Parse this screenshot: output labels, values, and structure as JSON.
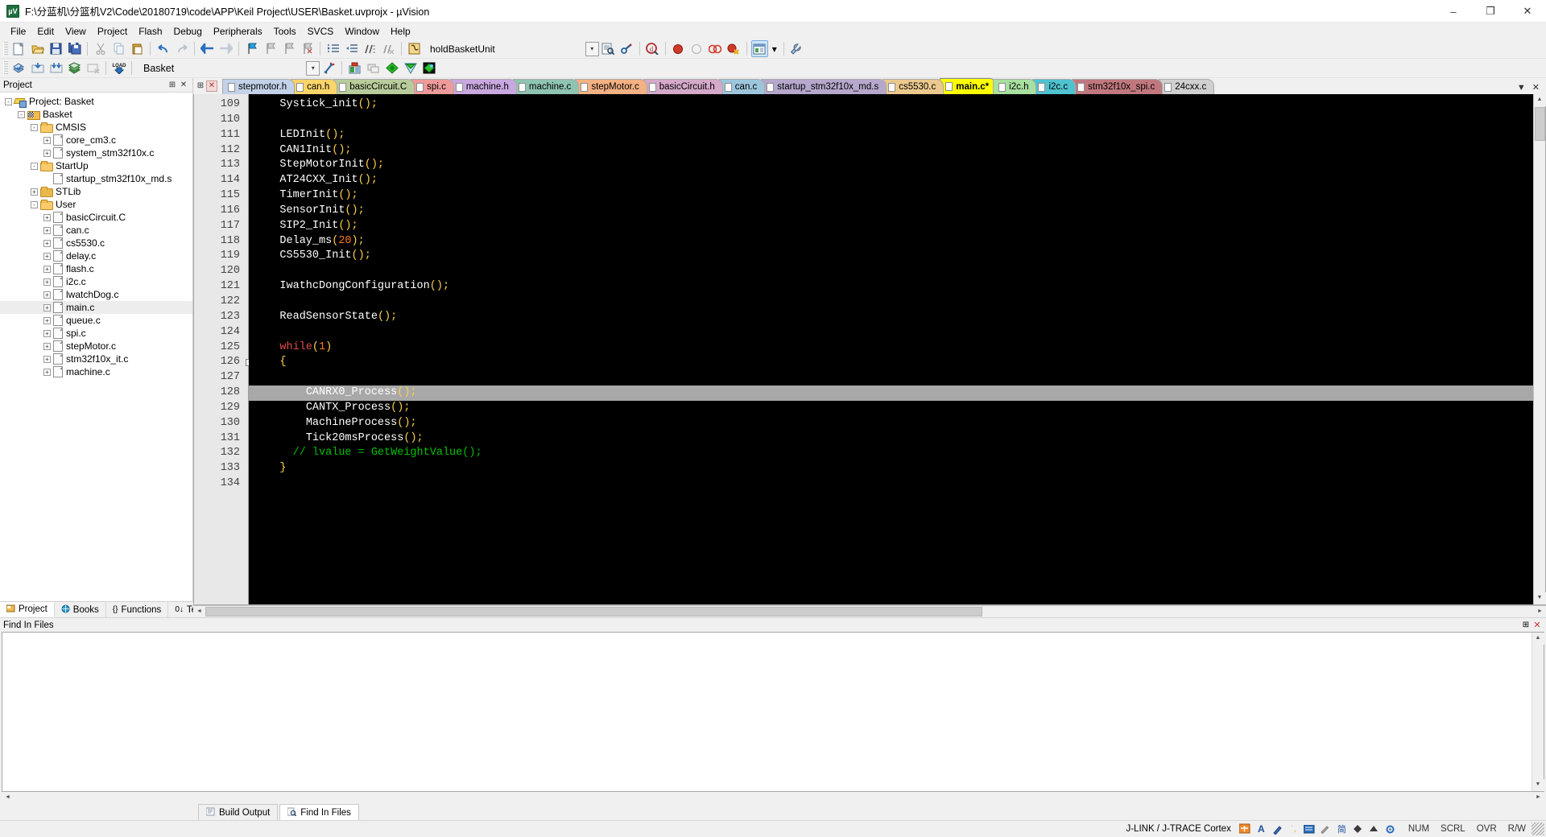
{
  "window": {
    "title": "F:\\分蓝机\\分篮机V2\\Code\\20180719\\code\\APP\\Keil Project\\USER\\Basket.uvprojx - µVision",
    "app_icon": "keil-uvision-icon",
    "minimize": "–",
    "maximize": "❐",
    "close": "✕"
  },
  "menu": [
    {
      "label": "File"
    },
    {
      "label": "Edit"
    },
    {
      "label": "View"
    },
    {
      "label": "Project"
    },
    {
      "label": "Flash"
    },
    {
      "label": "Debug"
    },
    {
      "label": "Peripherals"
    },
    {
      "label": "Tools"
    },
    {
      "label": "SVCS"
    },
    {
      "label": "Window"
    },
    {
      "label": "Help"
    }
  ],
  "toolbar_main": {
    "function_combo_value": "holdBasketUnit",
    "icons": [
      "new-file-icon",
      "open-file-icon",
      "save-icon",
      "save-all-icon",
      "cut-icon",
      "copy-icon",
      "paste-icon",
      "undo-icon",
      "redo-icon",
      "back-icon",
      "forward-icon",
      "bookmark-toggle-icon",
      "bookmark-prev-icon",
      "bookmark-next-icon",
      "bookmark-clear-icon",
      "indent-icon",
      "outdent-icon",
      "comment-icon",
      "uncomment-icon",
      "function-browse-icon"
    ],
    "right_icons": [
      "dropdown-arrow-icon",
      "find-in-files-icon",
      "configure-icon",
      "start-debug-icon",
      "breakpoint-icon",
      "breakpoint-disable-icon",
      "breakpoint-clear-icon",
      "breakpoint-kill-icon",
      "window-layout-icon",
      "layout-dropdown-icon",
      "configure-target-icon"
    ]
  },
  "toolbar_build": {
    "target_name": "Basket",
    "icons": [
      "translate-icon",
      "build-icon",
      "rebuild-icon",
      "batch-build-icon",
      "stop-build-icon",
      "download-icon"
    ],
    "right_icons": [
      "target-dropdown-icon",
      "target-options-icon",
      "manage-project-items-icon",
      "multi-project-icon",
      "component-icon",
      "pack-installer-icon",
      "pack-manage-icon"
    ]
  },
  "project_panel": {
    "title": "Project",
    "pin_icon": "pin-icon",
    "close_icon": "close-icon",
    "tree": [
      {
        "label": "Project: Basket",
        "depth": 0,
        "icon": "project-icon",
        "expander": "-"
      },
      {
        "label": "Basket",
        "depth": 1,
        "icon": "target-icon",
        "expander": "-"
      },
      {
        "label": "CMSIS",
        "depth": 2,
        "icon": "folder-open-icon",
        "expander": "-"
      },
      {
        "label": "core_cm3.c",
        "depth": 3,
        "icon": "file-icon",
        "expander": "+"
      },
      {
        "label": "system_stm32f10x.c",
        "depth": 3,
        "icon": "file-icon",
        "expander": "+"
      },
      {
        "label": "StartUp",
        "depth": 2,
        "icon": "folder-open-icon",
        "expander": "-"
      },
      {
        "label": "startup_stm32f10x_md.s",
        "depth": 3,
        "icon": "file-icon",
        "expander": ""
      },
      {
        "label": "STLib",
        "depth": 2,
        "icon": "folder-closed-icon",
        "expander": "+"
      },
      {
        "label": "User",
        "depth": 2,
        "icon": "folder-open-icon",
        "expander": "-"
      },
      {
        "label": "basicCircuit.C",
        "depth": 3,
        "icon": "file-icon",
        "expander": "+"
      },
      {
        "label": "can.c",
        "depth": 3,
        "icon": "file-icon",
        "expander": "+"
      },
      {
        "label": "cs5530.c",
        "depth": 3,
        "icon": "file-icon",
        "expander": "+"
      },
      {
        "label": "delay.c",
        "depth": 3,
        "icon": "file-icon",
        "expander": "+"
      },
      {
        "label": "flash.c",
        "depth": 3,
        "icon": "file-icon",
        "expander": "+"
      },
      {
        "label": "i2c.c",
        "depth": 3,
        "icon": "file-icon",
        "expander": "+"
      },
      {
        "label": "lwatchDog.c",
        "depth": 3,
        "icon": "file-icon",
        "expander": "+"
      },
      {
        "label": "main.c",
        "depth": 3,
        "icon": "file-icon",
        "expander": "+",
        "selected": true
      },
      {
        "label": "queue.c",
        "depth": 3,
        "icon": "file-icon",
        "expander": "+"
      },
      {
        "label": "spi.c",
        "depth": 3,
        "icon": "file-icon",
        "expander": "+"
      },
      {
        "label": "stepMotor.c",
        "depth": 3,
        "icon": "file-icon",
        "expander": "+"
      },
      {
        "label": "stm32f10x_it.c",
        "depth": 3,
        "icon": "file-icon",
        "expander": "+"
      },
      {
        "label": "machine.c",
        "depth": 3,
        "icon": "file-icon",
        "expander": "+"
      }
    ],
    "bottom_tabs": [
      {
        "label": "Project",
        "icon": "project-tab-icon",
        "active": true
      },
      {
        "label": "Books",
        "icon": "books-icon",
        "active": false
      },
      {
        "label": "Functions",
        "icon": "functions-icon",
        "active": false
      },
      {
        "label": "Templates",
        "icon": "templates-icon",
        "active": false
      }
    ]
  },
  "editor": {
    "tabs": [
      {
        "label": "stepmotor.h",
        "color": "#c3d2e8",
        "active": false
      },
      {
        "label": "can.h",
        "color": "#fbd56a",
        "active": false
      },
      {
        "label": "basicCircuit.C",
        "color": "#b8cc9b",
        "active": false
      },
      {
        "label": "spi.c",
        "color": "#ef9a9a",
        "active": false
      },
      {
        "label": "machine.h",
        "color": "#c9a8e0",
        "active": false
      },
      {
        "label": "machine.c",
        "color": "#8fc4b2",
        "active": false
      },
      {
        "label": "stepMotor.c",
        "color": "#f4b183",
        "active": false
      },
      {
        "label": "basicCircuit.h",
        "color": "#d5a9c9",
        "active": false
      },
      {
        "label": "can.c",
        "color": "#9dc6dd",
        "active": false
      },
      {
        "label": "startup_stm32f10x_md.s",
        "color": "#b6a8cc",
        "active": false
      },
      {
        "label": "cs5530.c",
        "color": "#ebc98d",
        "active": false
      },
      {
        "label": "main.c*",
        "color": "#ffff00",
        "active": true
      },
      {
        "label": "i2c.h",
        "color": "#a8e0a0",
        "active": false
      },
      {
        "label": "i2c.c",
        "color": "#4fc3d0",
        "active": false
      },
      {
        "label": "stm32f10x_spi.c",
        "color": "#c0787e",
        "active": false
      },
      {
        "label": "24cxx.c",
        "color": "#d0d0d0",
        "active": false
      }
    ],
    "tabstrip_left_icons": [
      "pin-icon",
      "close-tab-icon"
    ],
    "tabstrip_right_icons": [
      "tab-list-dropdown-icon",
      "close-document-icon"
    ],
    "first_line_number": 109,
    "lines": [
      {
        "n": 109,
        "tokens": [
          {
            "t": "    ",
            "c": "id"
          },
          {
            "t": "Systick_init",
            "c": "id"
          },
          {
            "t": "();",
            "c": "punct"
          }
        ]
      },
      {
        "n": 110,
        "tokens": []
      },
      {
        "n": 111,
        "tokens": [
          {
            "t": "    ",
            "c": "id"
          },
          {
            "t": "LEDInit",
            "c": "id"
          },
          {
            "t": "();",
            "c": "punct"
          }
        ]
      },
      {
        "n": 112,
        "tokens": [
          {
            "t": "    ",
            "c": "id"
          },
          {
            "t": "CAN1Init",
            "c": "id"
          },
          {
            "t": "();",
            "c": "punct"
          }
        ]
      },
      {
        "n": 113,
        "tokens": [
          {
            "t": "    ",
            "c": "id"
          },
          {
            "t": "StepMotorInit",
            "c": "id"
          },
          {
            "t": "();",
            "c": "punct"
          }
        ]
      },
      {
        "n": 114,
        "tokens": [
          {
            "t": "    ",
            "c": "id"
          },
          {
            "t": "AT24CXX_Init",
            "c": "id"
          },
          {
            "t": "();",
            "c": "punct"
          }
        ]
      },
      {
        "n": 115,
        "tokens": [
          {
            "t": "    ",
            "c": "id"
          },
          {
            "t": "TimerInit",
            "c": "id"
          },
          {
            "t": "();",
            "c": "punct"
          }
        ]
      },
      {
        "n": 116,
        "tokens": [
          {
            "t": "    ",
            "c": "id"
          },
          {
            "t": "SensorInit",
            "c": "id"
          },
          {
            "t": "();",
            "c": "punct"
          }
        ]
      },
      {
        "n": 117,
        "tokens": [
          {
            "t": "    ",
            "c": "id"
          },
          {
            "t": "SIP2_Init",
            "c": "id"
          },
          {
            "t": "();",
            "c": "punct"
          }
        ]
      },
      {
        "n": 118,
        "tokens": [
          {
            "t": "    ",
            "c": "id"
          },
          {
            "t": "Delay_ms",
            "c": "id"
          },
          {
            "t": "(",
            "c": "punct"
          },
          {
            "t": "20",
            "c": "num"
          },
          {
            "t": ");",
            "c": "punct"
          }
        ]
      },
      {
        "n": 119,
        "tokens": [
          {
            "t": "    ",
            "c": "id"
          },
          {
            "t": "CS5530_Init",
            "c": "id"
          },
          {
            "t": "();",
            "c": "punct"
          }
        ]
      },
      {
        "n": 120,
        "tokens": []
      },
      {
        "n": 121,
        "tokens": [
          {
            "t": "    ",
            "c": "id"
          },
          {
            "t": "IwathcDongConfiguration",
            "c": "id"
          },
          {
            "t": "();",
            "c": "punct"
          }
        ]
      },
      {
        "n": 122,
        "tokens": []
      },
      {
        "n": 123,
        "tokens": [
          {
            "t": "    ",
            "c": "id"
          },
          {
            "t": "ReadSensorState",
            "c": "id"
          },
          {
            "t": "();",
            "c": "punct"
          }
        ]
      },
      {
        "n": 124,
        "tokens": []
      },
      {
        "n": 125,
        "tokens": [
          {
            "t": "    ",
            "c": "id"
          },
          {
            "t": "while",
            "c": "kw"
          },
          {
            "t": "(",
            "c": "punct"
          },
          {
            "t": "1",
            "c": "num"
          },
          {
            "t": ")",
            "c": "punct"
          }
        ]
      },
      {
        "n": 126,
        "fold": "-",
        "tokens": [
          {
            "t": "    ",
            "c": "id"
          },
          {
            "t": "{",
            "c": "punct"
          }
        ]
      },
      {
        "n": 127,
        "tokens": []
      },
      {
        "n": 128,
        "highlight": true,
        "tokens": [
          {
            "t": "        ",
            "c": "id"
          },
          {
            "t": "CANRX0_Process",
            "c": "id"
          },
          {
            "t": "();",
            "c": "punct"
          }
        ]
      },
      {
        "n": 129,
        "tokens": [
          {
            "t": "        ",
            "c": "id"
          },
          {
            "t": "CANTX_Process",
            "c": "id"
          },
          {
            "t": "();",
            "c": "punct"
          }
        ]
      },
      {
        "n": 130,
        "tokens": [
          {
            "t": "        ",
            "c": "id"
          },
          {
            "t": "MachineProcess",
            "c": "id"
          },
          {
            "t": "();",
            "c": "punct"
          }
        ]
      },
      {
        "n": 131,
        "tokens": [
          {
            "t": "        ",
            "c": "id"
          },
          {
            "t": "Tick20msProcess",
            "c": "id"
          },
          {
            "t": "();",
            "c": "punct"
          }
        ]
      },
      {
        "n": 132,
        "tokens": [
          {
            "t": "      ",
            "c": "id"
          },
          {
            "t": "// lvalue = ",
            "c": "cmt"
          },
          {
            "t": "GetWeightValue();",
            "c": "cmt2"
          }
        ]
      },
      {
        "n": 133,
        "tokens": [
          {
            "t": "    ",
            "c": "id"
          },
          {
            "t": "}",
            "c": "punct"
          }
        ]
      },
      {
        "n": 134,
        "tokens": []
      }
    ]
  },
  "find_pane": {
    "title": "Find In Files",
    "pin_icon": "pin-icon",
    "close_icon": "close-icon",
    "content": ""
  },
  "bottom_tabs": [
    {
      "label": "Build Output",
      "icon": "build-output-icon",
      "active": false
    },
    {
      "label": "Find In Files",
      "icon": "find-in-files-icon",
      "active": true
    }
  ],
  "statusbar": {
    "left_text": "",
    "debug_adapter": "J-LINK / J-TRACE Cortex",
    "ime_icons": [
      "ime-icon",
      "ime-letter-a-icon",
      "ime-pen-icon",
      "ime-dot-icon",
      "ime-keyboard-icon",
      "ime-tool-icon",
      "ime-simplified-icon",
      "ime-punct-icon",
      "ime-half-width-icon",
      "ime-settings-icon"
    ],
    "cells": [
      "NUM",
      "SCRL",
      "OVR",
      "R/W"
    ],
    "resize_grip": "resize-grip-icon"
  },
  "colors": {
    "editor_bg": "#000000",
    "gutter_bg": "#e8e8e8",
    "highlight_line": "#a8a8a8",
    "keyword": "#e04a4a",
    "number": "#ff7a18",
    "punct": "#ffd24a",
    "comment": "#00c000",
    "identifier": "#ffffff",
    "active_tab": "#ffff00",
    "chrome": "#f0f0f0"
  }
}
